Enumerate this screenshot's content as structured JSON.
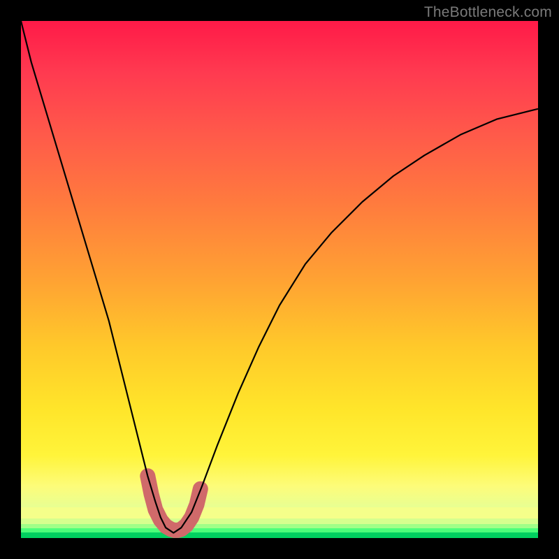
{
  "watermark": "TheBottleneck.com",
  "chart_data": {
    "type": "line",
    "title": "",
    "xlabel": "",
    "ylabel": "",
    "xlim": [
      0,
      100
    ],
    "ylim": [
      0,
      100
    ],
    "grid": false,
    "legend": false,
    "series": [
      {
        "name": "bottleneck-curve",
        "color": "#000000",
        "x": [
          0,
          2,
          5,
          8,
          11,
          14,
          17,
          19,
          21,
          23,
          24.5,
          26,
          27,
          28,
          29.5,
          31,
          33,
          35,
          38,
          42,
          46,
          50,
          55,
          60,
          66,
          72,
          78,
          85,
          92,
          100
        ],
        "y": [
          100,
          92,
          82,
          72,
          62,
          52,
          42,
          34,
          26,
          18,
          12,
          7,
          4,
          2,
          1,
          2,
          5,
          10,
          18,
          28,
          37,
          45,
          53,
          59,
          65,
          70,
          74,
          78,
          81,
          83
        ]
      },
      {
        "name": "optimal-marker",
        "type": "scatter",
        "color": "#d46a6a",
        "stroke_width": 12,
        "x": [
          24.5,
          25.2,
          26.0,
          27.0,
          28.0,
          29.0,
          29.7,
          30.3,
          31.0,
          32.0,
          33.0,
          34.0,
          34.7
        ],
        "y": [
          12.0,
          8.5,
          5.5,
          3.5,
          2.3,
          1.7,
          1.5,
          1.5,
          1.7,
          2.5,
          4.0,
          6.5,
          9.5
        ]
      }
    ],
    "background_bands": [
      {
        "label": "red",
        "y_range": [
          80,
          100
        ],
        "color": "#ff2a4a"
      },
      {
        "label": "orange",
        "y_range": [
          45,
          80
        ],
        "color": "#ff8a38"
      },
      {
        "label": "yellow",
        "y_range": [
          12,
          45
        ],
        "color": "#ffe030"
      },
      {
        "label": "pale",
        "y_range": [
          4,
          12
        ],
        "color": "#f6ff88"
      },
      {
        "label": "green",
        "y_range": [
          0,
          4
        ],
        "color": "#2fe568"
      }
    ]
  }
}
